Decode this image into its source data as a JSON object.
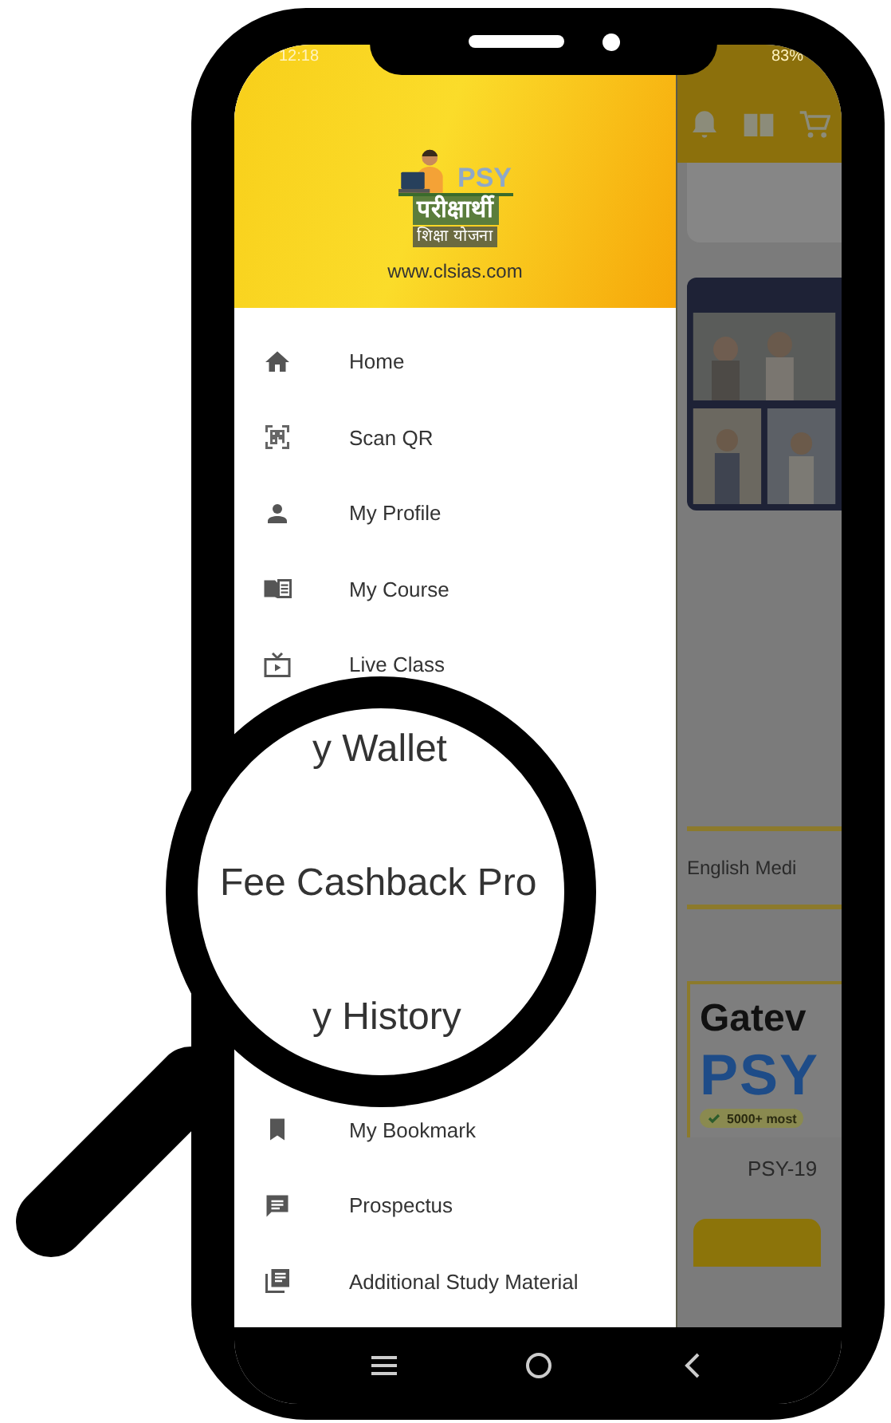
{
  "status_bar": {
    "time": "12:18",
    "battery": "83%"
  },
  "drawer": {
    "logo": {
      "brand": "PSY",
      "hindi_title": "परीक्षार्थी",
      "hindi_subtitle": "शिक्षा योजना"
    },
    "website": "www.clsias.com",
    "items": [
      {
        "label": "Home",
        "kind": "home"
      },
      {
        "label": "Scan QR",
        "kind": "qr"
      },
      {
        "label": "My Profile",
        "kind": "person"
      },
      {
        "label": "My Course",
        "kind": "book"
      },
      {
        "label": "Live Class",
        "kind": "tv"
      }
    ],
    "magnified": [
      {
        "text": "y Wallet",
        "kind": "heading"
      },
      {
        "text": "Fee Cashback Pro",
        "kind": "item"
      },
      {
        "text": "y History",
        "kind": "heading"
      }
    ],
    "items_after": [
      {
        "label": "My Bookmark",
        "kind": "bookmark"
      },
      {
        "label": "Prospectus",
        "kind": "chat"
      },
      {
        "label": "Additional Study Material",
        "kind": "library"
      }
    ]
  },
  "background_app": {
    "tab": "English Medi",
    "course_card": {
      "title": "Gatev",
      "logo": "PSY",
      "badge": "5000+ most",
      "code": "PSY-19"
    }
  }
}
